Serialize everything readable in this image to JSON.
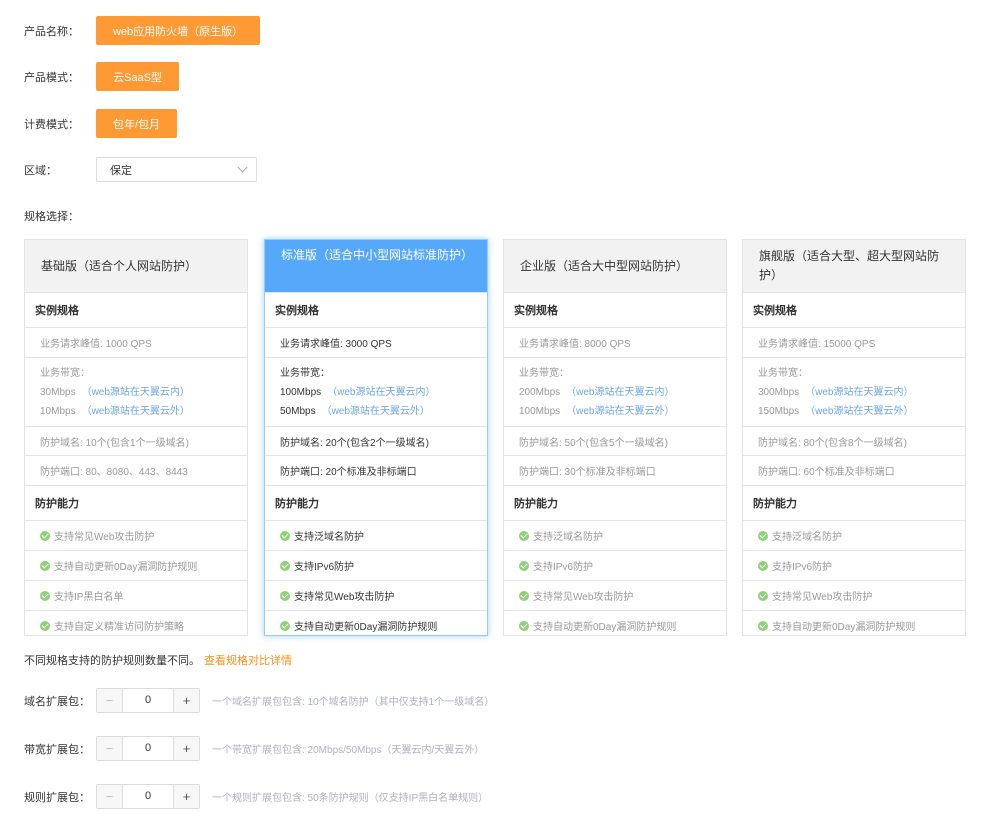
{
  "product": {
    "label": "产品名称：",
    "value": "web应用防火墙（原生版）"
  },
  "mode": {
    "label": "产品模式：",
    "value": "云SaaS型"
  },
  "billing": {
    "label": "计费模式：",
    "value": "包年/包月"
  },
  "region": {
    "label": "区域：",
    "value": "保定"
  },
  "spec_label": "规格选择：",
  "plans": [
    {
      "title": "基础版（适合个人网站防护）",
      "instance_title": "实例规格",
      "qps": "业务请求峰值: 1000 QPS",
      "bw_label": "业务带宽：",
      "bw_in": "30Mbps",
      "bw_in_note": "（web源站在天翼云内）",
      "bw_out": "10Mbps",
      "bw_out_note": "（web源站在天翼云外）",
      "domains": "防护域名: 10个(包含1个一级域名)",
      "ports": "防护端口: 80、8080、443、8443",
      "ability_title": "防护能力",
      "features": [
        "支持常见Web攻击防护",
        "支持自动更新0Day漏洞防护规则",
        "支持IP黑白名单",
        "支持自定义精准访问防护策略"
      ]
    },
    {
      "title": "标准版（适合中小型网站标准防护）",
      "instance_title": "实例规格",
      "qps": "业务请求峰值: 3000 QPS",
      "bw_label": "业务带宽：",
      "bw_in": "100Mbps",
      "bw_in_note": "（web源站在天翼云内）",
      "bw_out": "50Mbps",
      "bw_out_note": "（web源站在天翼云外）",
      "domains": "防护域名: 20个(包含2个一级域名)",
      "ports": "防护端口: 20个标准及非标端口",
      "ability_title": "防护能力",
      "features": [
        "支持泛域名防护",
        "支持IPv6防护",
        "支持常见Web攻击防护",
        "支持自动更新0Day漏洞防护规则"
      ]
    },
    {
      "title": "企业版（适合大中型网站防护）",
      "instance_title": "实例规格",
      "qps": "业务请求峰值: 8000 QPS",
      "bw_label": "业务带宽：",
      "bw_in": "200Mbps",
      "bw_in_note": "（web源站在天翼云内）",
      "bw_out": "100Mbps",
      "bw_out_note": "（web源站在天翼云外）",
      "domains": "防护域名: 50个(包含5个一级域名)",
      "ports": "防护端口: 30个标准及非标端口",
      "ability_title": "防护能力",
      "features": [
        "支持泛域名防护",
        "支持IPv6防护",
        "支持常见Web攻击防护",
        "支持自动更新0Day漏洞防护规则"
      ]
    },
    {
      "title": "旗舰版（适合大型、超大型网站防护）",
      "instance_title": "实例规格",
      "qps": "业务请求峰值: 15000 QPS",
      "bw_label": "业务带宽：",
      "bw_in": "300Mbps",
      "bw_in_note": "（web源站在天翼云内）",
      "bw_out": "150Mbps",
      "bw_out_note": "（web源站在天翼云外）",
      "domains": "防护域名: 80个(包含8个一级域名)",
      "ports": "防护端口: 60个标准及非标端口",
      "ability_title": "防护能力",
      "features": [
        "支持泛域名防护",
        "支持IPv6防护",
        "支持常见Web攻击防护",
        "支持自动更新0Day漏洞防护规则"
      ]
    }
  ],
  "selected_plan": 1,
  "notice": {
    "text": "不同规格支持的防护规则数量不同。",
    "link": "查看规格对比详情"
  },
  "extensions": [
    {
      "label": "域名扩展包：",
      "value": "0",
      "hint": "一个域名扩展包包含: 10个域名防护（其中仅支持1个一级域名）"
    },
    {
      "label": "带宽扩展包：",
      "value": "0",
      "hint": "一个带宽扩展包包含: 20Mbps/50Mbps（天翼云内/天翼云外）"
    },
    {
      "label": "规则扩展包：",
      "value": "0",
      "hint": "一个规则扩展包包含: 50条防护规则（仅支持IP黑白名单规则）"
    }
  ],
  "stepper_minus": "−",
  "stepper_plus": "+",
  "colors": {
    "accent": "#ff9933",
    "selected": "#56a9fa",
    "check": "#8fd07a",
    "link": "#ff8c1a"
  }
}
